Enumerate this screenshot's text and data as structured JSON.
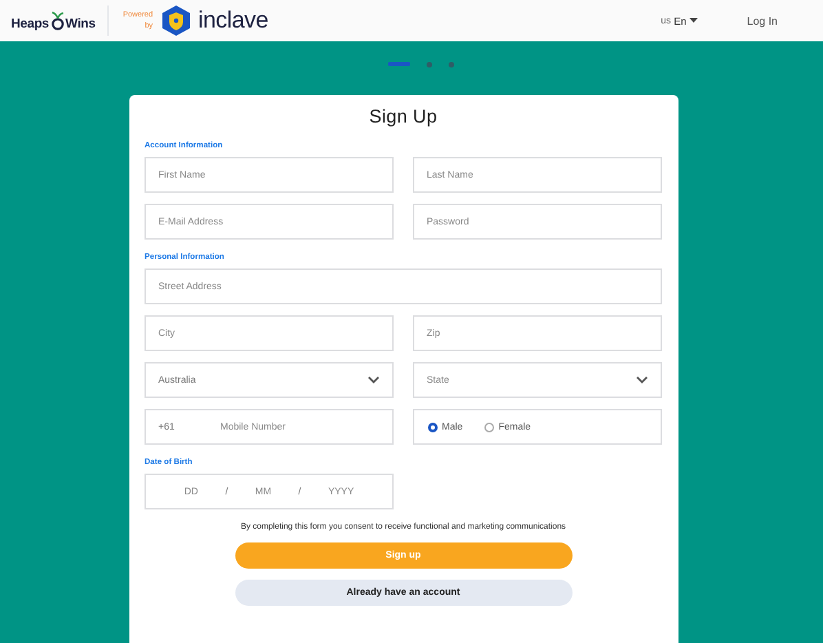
{
  "header": {
    "logo": {
      "left": "Heaps",
      "right": "Wins"
    },
    "powered_by": [
      "Powered",
      "by"
    ],
    "brand": "inclave",
    "language": {
      "region": "us",
      "code": "En"
    },
    "login": "Log In"
  },
  "steps": [
    {
      "selected": true
    },
    {
      "selected": false
    },
    {
      "selected": false
    }
  ],
  "form": {
    "title": "Sign Up",
    "sections": [
      {
        "heading": "Account Information",
        "rows": [
          [
            {
              "kind": "text",
              "placeholder": "First Name"
            },
            {
              "kind": "text",
              "placeholder": "Last Name"
            }
          ],
          [
            {
              "kind": "text",
              "placeholder": "E-Mail Address"
            },
            {
              "kind": "password",
              "placeholder": "Password"
            }
          ]
        ]
      },
      {
        "heading": "Personal Information",
        "rows": [
          [
            {
              "kind": "text",
              "placeholder": "Street Address"
            }
          ],
          [
            {
              "kind": "text",
              "placeholder": "City"
            },
            {
              "kind": "text",
              "placeholder": "Zip"
            }
          ],
          [
            {
              "kind": "select",
              "value": "Australia"
            },
            {
              "kind": "select",
              "placeholder": "State"
            }
          ],
          [
            {
              "kind": "phone",
              "prefix": "+61",
              "placeholder": "Mobile Number"
            },
            {
              "kind": "radio",
              "options": [
                {
                  "label": "Male",
                  "selected": true
                },
                {
                  "label": "Female",
                  "selected": false
                }
              ]
            }
          ]
        ]
      },
      {
        "heading": "Date of Birth",
        "rows": [
          [
            {
              "kind": "date",
              "parts": [
                "DD",
                "MM",
                "YYYY"
              ],
              "separator": "/"
            }
          ]
        ]
      }
    ],
    "consent": "By completing this form you consent to receive functional and marketing communications",
    "buttons": [
      {
        "kind": "primary",
        "label": "Sign up"
      },
      {
        "kind": "secondary",
        "label": "Already have an account"
      }
    ]
  }
}
